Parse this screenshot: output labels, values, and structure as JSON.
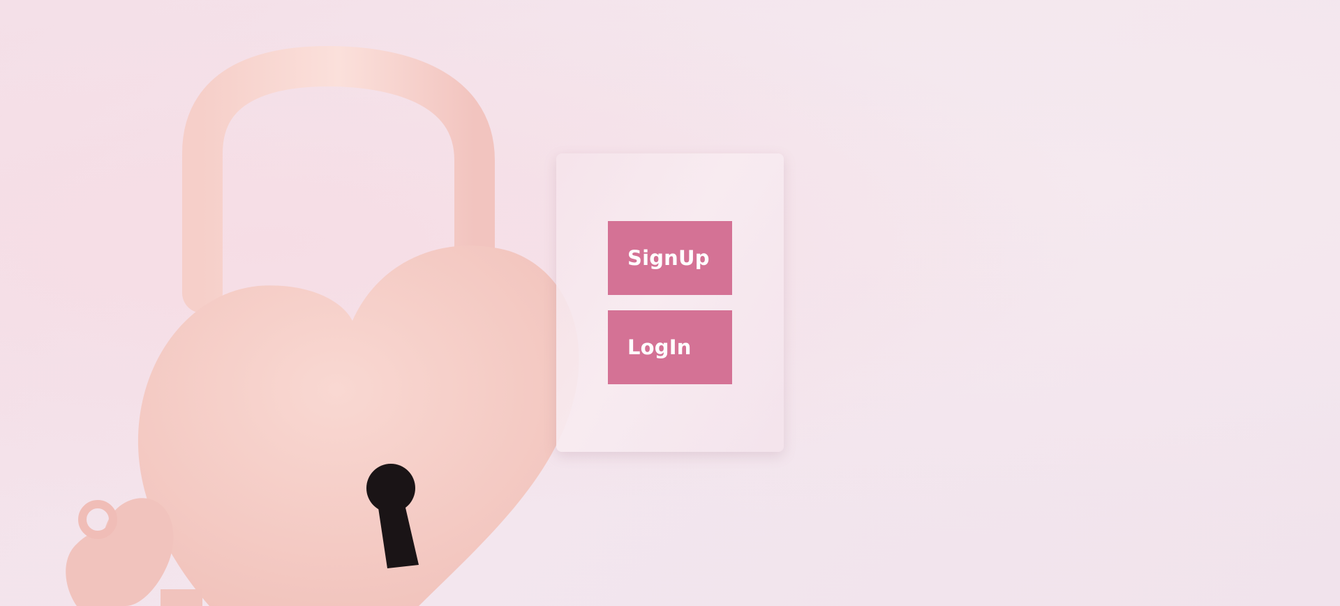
{
  "auth_card": {
    "signup_label": "SignUp",
    "login_label": "LogIn"
  },
  "background": {
    "image_icon": "heart-padlock-icon",
    "accent_color": "#d47295"
  }
}
